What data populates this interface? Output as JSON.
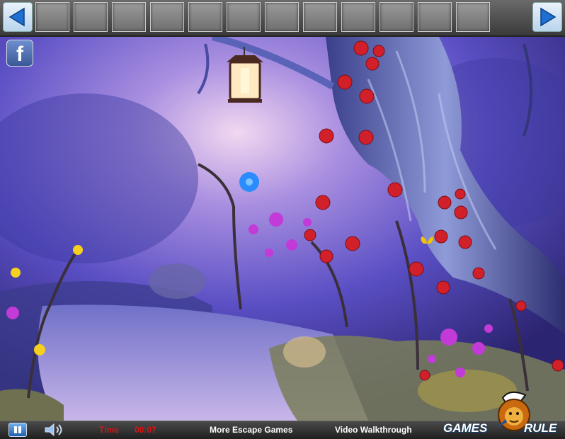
{
  "header": {
    "prev_icon": "left-arrow-icon",
    "next_icon": "right-arrow-icon",
    "inventory_slots": 13
  },
  "social": {
    "facebook_label": "f"
  },
  "footer": {
    "time_label": "Time",
    "time_value": "00:07",
    "more_games": "More Escape Games",
    "walkthrough": "Video Walkthrough"
  },
  "logo": {
    "word1": "GAMES",
    "word2": "RULE",
    "mascot_icon": "lion-mascot-icon"
  },
  "colors": {
    "time_red": "#e01010",
    "scene_purple": "#5a5ac8",
    "rose_red": "#d2202a",
    "flower_blue": "#2a8cff",
    "flower_magenta": "#c23ad8"
  }
}
